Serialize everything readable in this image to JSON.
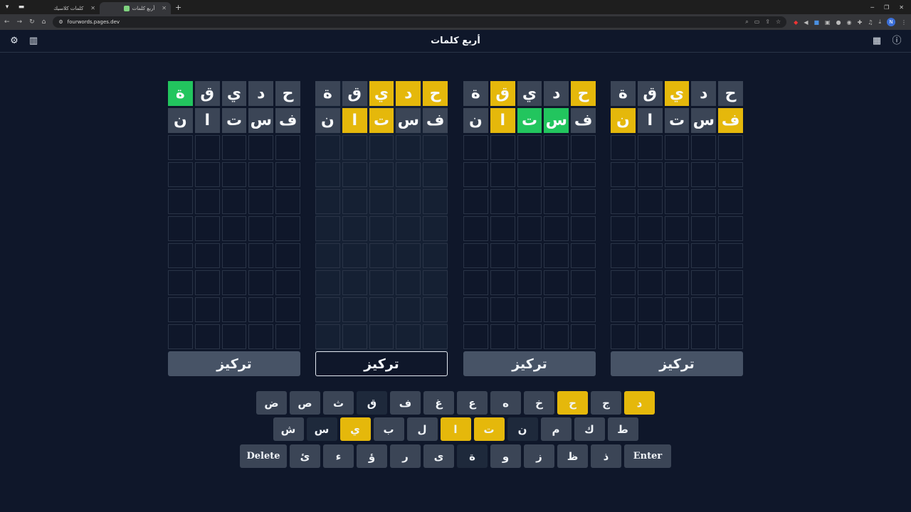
{
  "browser": {
    "tabs": [
      {
        "label": "كلمات كلاسيك",
        "active": false
      },
      {
        "label": "أربع كلمات",
        "active": true
      }
    ],
    "url": "fourwords.pages.dev",
    "profile_initial": "N"
  },
  "app": {
    "title": "أربع كلمات",
    "icons": {
      "settings": "gear-icon",
      "stats": "bar-chart-icon",
      "calendar": "calendar-icon",
      "info": "info-icon"
    }
  },
  "boards": [
    {
      "focused": false,
      "focus_label": "تركيز",
      "rows": [
        [
          {
            "l": "ح",
            "s": "gray"
          },
          {
            "l": "د",
            "s": "gray"
          },
          {
            "l": "ي",
            "s": "gray"
          },
          {
            "l": "ق",
            "s": "gray"
          },
          {
            "l": "ة",
            "s": "green"
          }
        ],
        [
          {
            "l": "ف",
            "s": "gray"
          },
          {
            "l": "س",
            "s": "gray"
          },
          {
            "l": "ت",
            "s": "gray"
          },
          {
            "l": "ا",
            "s": "gray"
          },
          {
            "l": "ن",
            "s": "gray"
          }
        ]
      ]
    },
    {
      "focused": true,
      "focus_label": "تركيز",
      "rows": [
        [
          {
            "l": "ح",
            "s": "yellow"
          },
          {
            "l": "د",
            "s": "yellow"
          },
          {
            "l": "ي",
            "s": "yellow"
          },
          {
            "l": "ق",
            "s": "gray"
          },
          {
            "l": "ة",
            "s": "gray"
          }
        ],
        [
          {
            "l": "ف",
            "s": "gray"
          },
          {
            "l": "س",
            "s": "gray"
          },
          {
            "l": "ت",
            "s": "yellow"
          },
          {
            "l": "ا",
            "s": "yellow"
          },
          {
            "l": "ن",
            "s": "gray"
          }
        ]
      ]
    },
    {
      "focused": false,
      "focus_label": "تركيز",
      "rows": [
        [
          {
            "l": "ح",
            "s": "yellow"
          },
          {
            "l": "د",
            "s": "gray"
          },
          {
            "l": "ي",
            "s": "gray"
          },
          {
            "l": "ق",
            "s": "yellow"
          },
          {
            "l": "ة",
            "s": "gray"
          }
        ],
        [
          {
            "l": "ف",
            "s": "gray"
          },
          {
            "l": "س",
            "s": "green"
          },
          {
            "l": "ت",
            "s": "green"
          },
          {
            "l": "ا",
            "s": "yellow"
          },
          {
            "l": "ن",
            "s": "gray"
          }
        ]
      ]
    },
    {
      "focused": false,
      "focus_label": "تركيز",
      "rows": [
        [
          {
            "l": "ح",
            "s": "gray"
          },
          {
            "l": "د",
            "s": "gray"
          },
          {
            "l": "ي",
            "s": "yellow"
          },
          {
            "l": "ق",
            "s": "gray"
          },
          {
            "l": "ة",
            "s": "gray"
          }
        ],
        [
          {
            "l": "ف",
            "s": "yellow"
          },
          {
            "l": "س",
            "s": "gray"
          },
          {
            "l": "ت",
            "s": "gray"
          },
          {
            "l": "ا",
            "s": "gray"
          },
          {
            "l": "ن",
            "s": "yellow"
          }
        ]
      ]
    }
  ],
  "total_rows": 10,
  "keyboard": [
    [
      {
        "k": "د",
        "s": "yellow"
      },
      {
        "k": "ج",
        "s": "gray"
      },
      {
        "k": "ح",
        "s": "yellow"
      },
      {
        "k": "خ",
        "s": "gray"
      },
      {
        "k": "ه",
        "s": "gray"
      },
      {
        "k": "ع",
        "s": "gray"
      },
      {
        "k": "غ",
        "s": "gray"
      },
      {
        "k": "ف",
        "s": "gray"
      },
      {
        "k": "ق",
        "s": "dark"
      },
      {
        "k": "ث",
        "s": "gray"
      },
      {
        "k": "ص",
        "s": "gray"
      },
      {
        "k": "ض",
        "s": "gray"
      }
    ],
    [
      {
        "k": "ط",
        "s": "gray"
      },
      {
        "k": "ك",
        "s": "gray"
      },
      {
        "k": "م",
        "s": "gray"
      },
      {
        "k": "ن",
        "s": "dark"
      },
      {
        "k": "ت",
        "s": "yellow"
      },
      {
        "k": "ا",
        "s": "yellow"
      },
      {
        "k": "ل",
        "s": "gray"
      },
      {
        "k": "ب",
        "s": "gray"
      },
      {
        "k": "ي",
        "s": "yellow"
      },
      {
        "k": "س",
        "s": "dark"
      },
      {
        "k": "ش",
        "s": "gray"
      }
    ],
    [
      {
        "k": "Enter",
        "s": "wide"
      },
      {
        "k": "ذ",
        "s": "gray"
      },
      {
        "k": "ظ",
        "s": "gray"
      },
      {
        "k": "ز",
        "s": "gray"
      },
      {
        "k": "و",
        "s": "gray"
      },
      {
        "k": "ة",
        "s": "dark"
      },
      {
        "k": "ى",
        "s": "gray"
      },
      {
        "k": "ر",
        "s": "gray"
      },
      {
        "k": "ؤ",
        "s": "gray"
      },
      {
        "k": "ء",
        "s": "gray"
      },
      {
        "k": "ئ",
        "s": "gray"
      },
      {
        "k": "Delete",
        "s": "wide"
      }
    ]
  ]
}
